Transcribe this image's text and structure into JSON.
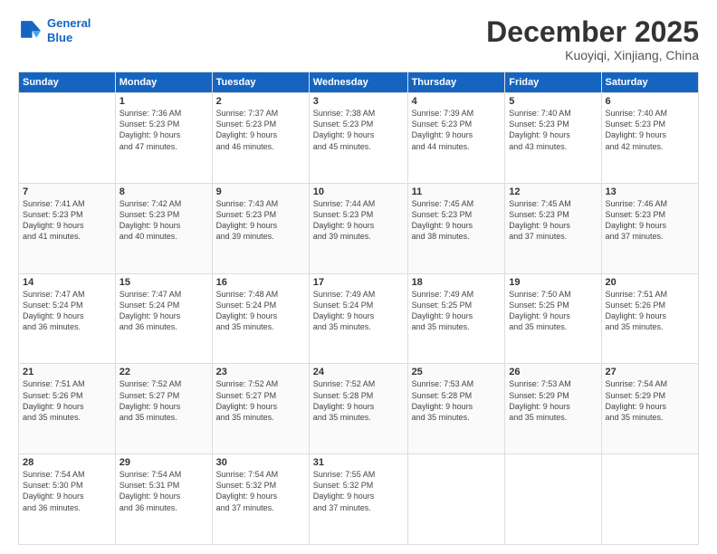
{
  "header": {
    "logo_line1": "General",
    "logo_line2": "Blue",
    "month": "December 2025",
    "location": "Kuoyiqi, Xinjiang, China"
  },
  "days_of_week": [
    "Sunday",
    "Monday",
    "Tuesday",
    "Wednesday",
    "Thursday",
    "Friday",
    "Saturday"
  ],
  "weeks": [
    [
      {
        "day": "",
        "info": ""
      },
      {
        "day": "1",
        "info": "Sunrise: 7:36 AM\nSunset: 5:23 PM\nDaylight: 9 hours\nand 47 minutes."
      },
      {
        "day": "2",
        "info": "Sunrise: 7:37 AM\nSunset: 5:23 PM\nDaylight: 9 hours\nand 46 minutes."
      },
      {
        "day": "3",
        "info": "Sunrise: 7:38 AM\nSunset: 5:23 PM\nDaylight: 9 hours\nand 45 minutes."
      },
      {
        "day": "4",
        "info": "Sunrise: 7:39 AM\nSunset: 5:23 PM\nDaylight: 9 hours\nand 44 minutes."
      },
      {
        "day": "5",
        "info": "Sunrise: 7:40 AM\nSunset: 5:23 PM\nDaylight: 9 hours\nand 43 minutes."
      },
      {
        "day": "6",
        "info": "Sunrise: 7:40 AM\nSunset: 5:23 PM\nDaylight: 9 hours\nand 42 minutes."
      }
    ],
    [
      {
        "day": "7",
        "info": "Sunrise: 7:41 AM\nSunset: 5:23 PM\nDaylight: 9 hours\nand 41 minutes."
      },
      {
        "day": "8",
        "info": "Sunrise: 7:42 AM\nSunset: 5:23 PM\nDaylight: 9 hours\nand 40 minutes."
      },
      {
        "day": "9",
        "info": "Sunrise: 7:43 AM\nSunset: 5:23 PM\nDaylight: 9 hours\nand 39 minutes."
      },
      {
        "day": "10",
        "info": "Sunrise: 7:44 AM\nSunset: 5:23 PM\nDaylight: 9 hours\nand 39 minutes."
      },
      {
        "day": "11",
        "info": "Sunrise: 7:45 AM\nSunset: 5:23 PM\nDaylight: 9 hours\nand 38 minutes."
      },
      {
        "day": "12",
        "info": "Sunrise: 7:45 AM\nSunset: 5:23 PM\nDaylight: 9 hours\nand 37 minutes."
      },
      {
        "day": "13",
        "info": "Sunrise: 7:46 AM\nSunset: 5:23 PM\nDaylight: 9 hours\nand 37 minutes."
      }
    ],
    [
      {
        "day": "14",
        "info": "Sunrise: 7:47 AM\nSunset: 5:24 PM\nDaylight: 9 hours\nand 36 minutes."
      },
      {
        "day": "15",
        "info": "Sunrise: 7:47 AM\nSunset: 5:24 PM\nDaylight: 9 hours\nand 36 minutes."
      },
      {
        "day": "16",
        "info": "Sunrise: 7:48 AM\nSunset: 5:24 PM\nDaylight: 9 hours\nand 35 minutes."
      },
      {
        "day": "17",
        "info": "Sunrise: 7:49 AM\nSunset: 5:24 PM\nDaylight: 9 hours\nand 35 minutes."
      },
      {
        "day": "18",
        "info": "Sunrise: 7:49 AM\nSunset: 5:25 PM\nDaylight: 9 hours\nand 35 minutes."
      },
      {
        "day": "19",
        "info": "Sunrise: 7:50 AM\nSunset: 5:25 PM\nDaylight: 9 hours\nand 35 minutes."
      },
      {
        "day": "20",
        "info": "Sunrise: 7:51 AM\nSunset: 5:26 PM\nDaylight: 9 hours\nand 35 minutes."
      }
    ],
    [
      {
        "day": "21",
        "info": "Sunrise: 7:51 AM\nSunset: 5:26 PM\nDaylight: 9 hours\nand 35 minutes."
      },
      {
        "day": "22",
        "info": "Sunrise: 7:52 AM\nSunset: 5:27 PM\nDaylight: 9 hours\nand 35 minutes."
      },
      {
        "day": "23",
        "info": "Sunrise: 7:52 AM\nSunset: 5:27 PM\nDaylight: 9 hours\nand 35 minutes."
      },
      {
        "day": "24",
        "info": "Sunrise: 7:52 AM\nSunset: 5:28 PM\nDaylight: 9 hours\nand 35 minutes."
      },
      {
        "day": "25",
        "info": "Sunrise: 7:53 AM\nSunset: 5:28 PM\nDaylight: 9 hours\nand 35 minutes."
      },
      {
        "day": "26",
        "info": "Sunrise: 7:53 AM\nSunset: 5:29 PM\nDaylight: 9 hours\nand 35 minutes."
      },
      {
        "day": "27",
        "info": "Sunrise: 7:54 AM\nSunset: 5:29 PM\nDaylight: 9 hours\nand 35 minutes."
      }
    ],
    [
      {
        "day": "28",
        "info": "Sunrise: 7:54 AM\nSunset: 5:30 PM\nDaylight: 9 hours\nand 36 minutes."
      },
      {
        "day": "29",
        "info": "Sunrise: 7:54 AM\nSunset: 5:31 PM\nDaylight: 9 hours\nand 36 minutes."
      },
      {
        "day": "30",
        "info": "Sunrise: 7:54 AM\nSunset: 5:32 PM\nDaylight: 9 hours\nand 37 minutes."
      },
      {
        "day": "31",
        "info": "Sunrise: 7:55 AM\nSunset: 5:32 PM\nDaylight: 9 hours\nand 37 minutes."
      },
      {
        "day": "",
        "info": ""
      },
      {
        "day": "",
        "info": ""
      },
      {
        "day": "",
        "info": ""
      }
    ]
  ]
}
